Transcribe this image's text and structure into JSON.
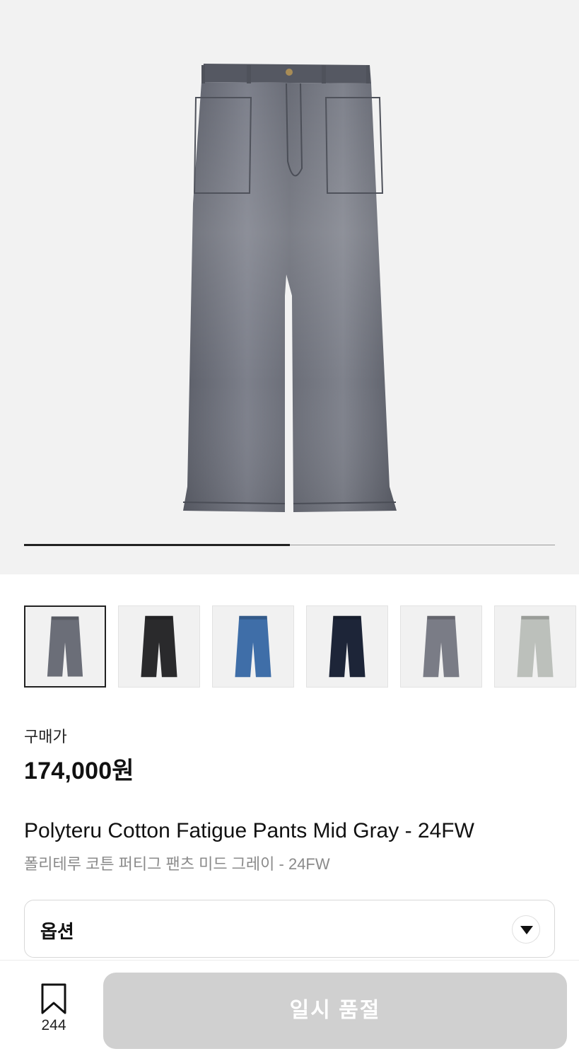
{
  "gallery": {
    "progress": 0.5,
    "main_image": "pants-mid-gray-product-photo",
    "thumbnails": [
      {
        "name": "mid-gray",
        "color": "#6b6e78",
        "selected": true
      },
      {
        "name": "black",
        "color": "#2a2a2c",
        "selected": false
      },
      {
        "name": "blue",
        "color": "#3f6ea8",
        "selected": false
      },
      {
        "name": "navy",
        "color": "#1d2538",
        "selected": false
      },
      {
        "name": "gray",
        "color": "#7a7c86",
        "selected": false
      },
      {
        "name": "light-gray",
        "color": "#bcc0bb",
        "selected": false
      }
    ]
  },
  "price": {
    "label": "구매가",
    "value": "174,000원"
  },
  "product": {
    "title_en": "Polyteru Cotton Fatigue Pants Mid Gray - 24FW",
    "title_ko": "폴리테루 코튼 퍼티그 팬츠 미드 그레이 - 24FW"
  },
  "option": {
    "label": "옵션",
    "icon": "chevron-down-icon"
  },
  "bottom_bar": {
    "bookmark_icon": "bookmark-icon",
    "bookmark_count": "244",
    "cta_label": "일시 품절"
  },
  "colors": {
    "hero_bg": "#f2f2f2",
    "cta_disabled": "#d0d0d0"
  }
}
